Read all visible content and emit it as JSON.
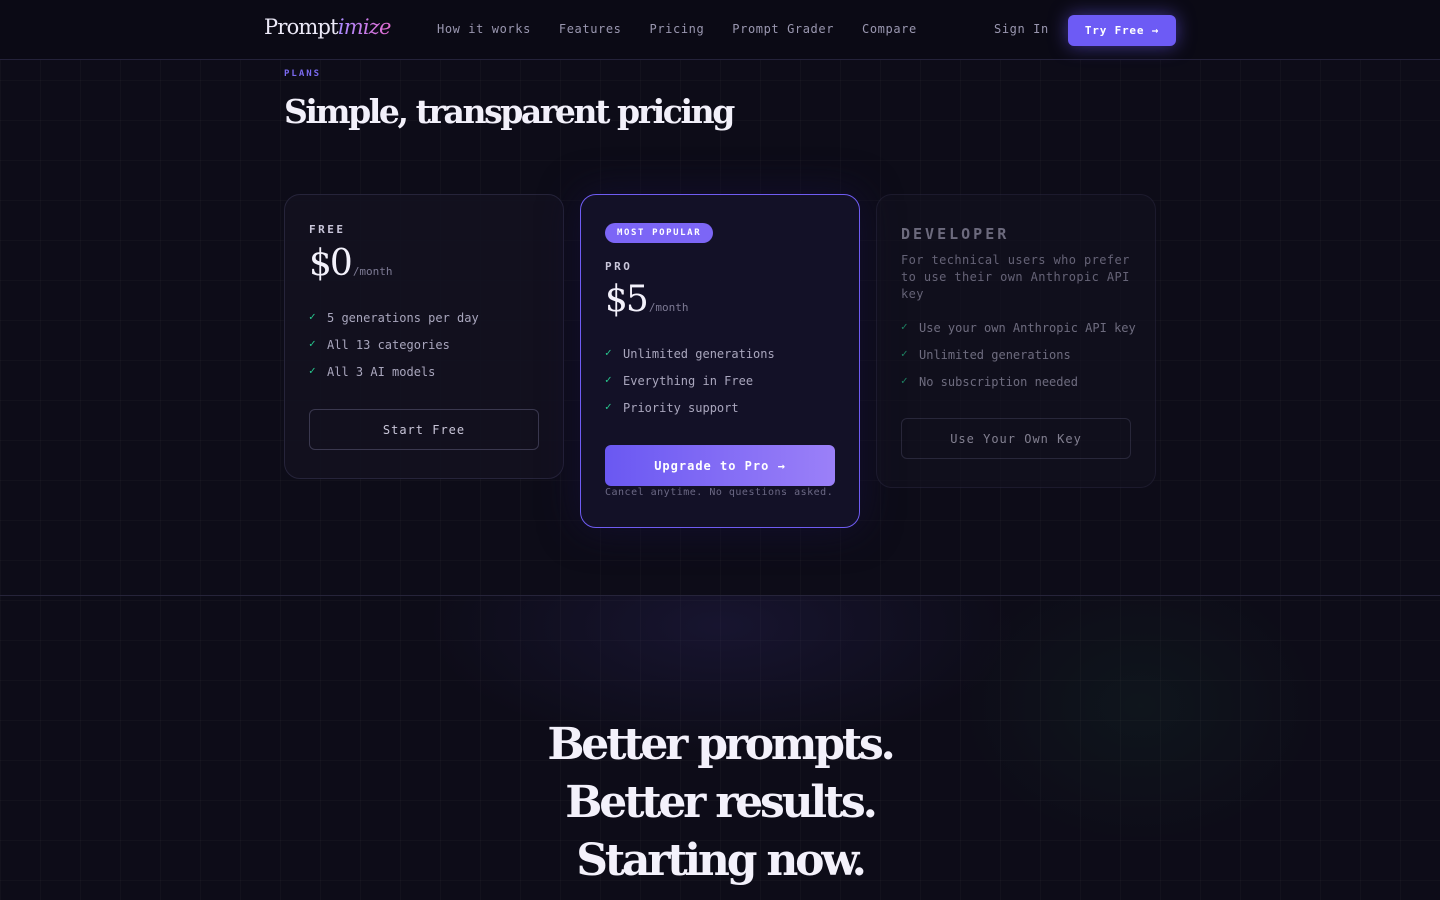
{
  "nav": {
    "logo_main": "Prompt",
    "logo_accent": "imize",
    "links": [
      "How it works",
      "Features",
      "Pricing",
      "Prompt Grader",
      "Compare"
    ],
    "sign_in": "Sign In",
    "try_free": "Try Free →"
  },
  "plans": {
    "eyebrow": "PLANS",
    "title": "Simple, transparent pricing",
    "free": {
      "tier": "FREE",
      "price": "$0",
      "period": "/month",
      "features": [
        "5 generations per day",
        "All 13 categories",
        "All 3 AI models"
      ],
      "button": "Start Free"
    },
    "pro": {
      "badge": "MOST POPULAR",
      "tier": "PRO",
      "price": "$5",
      "period": "/month",
      "features": [
        "Unlimited generations",
        "Everything in Free",
        "Priority support"
      ],
      "button": "Upgrade to Pro →",
      "fine_print": "Cancel anytime. No questions asked."
    },
    "developer": {
      "tier": "DEVELOPER",
      "description": "For technical users who prefer to use their own Anthropic API key",
      "features": [
        "Use your own Anthropic API key",
        "Unlimited generations",
        "No subscription needed"
      ],
      "button": "Use Your Own Key"
    },
    "check_glyph": "✓"
  },
  "cta": {
    "lines": [
      "Better prompts.",
      "Better results.",
      "Starting now."
    ]
  },
  "colors": {
    "background": "#0d0c18",
    "accent": "#6d5bf5",
    "check": "#27c98f"
  }
}
